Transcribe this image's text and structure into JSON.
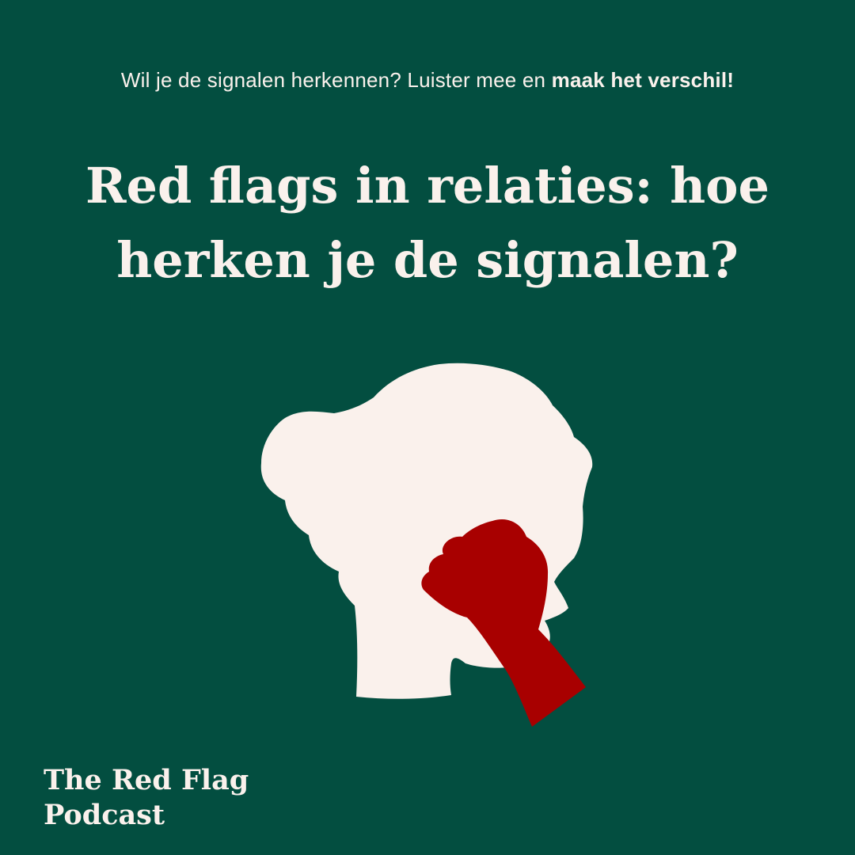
{
  "tagline": {
    "regular": "Wil je de signalen herkennen? Luister mee en ",
    "bold": "maak het verschil!"
  },
  "headline": {
    "line1": "Red flags in relaties: hoe",
    "line2": "herken je de signalen?"
  },
  "brand": {
    "line1": "The Red Flag",
    "line2": "Podcast"
  },
  "illustration": {
    "head_icon": "head-silhouette-icon",
    "fist_icon": "fist-icon"
  },
  "colors": {
    "background": "#034e40",
    "cream": "#faf1ec",
    "red": "#a80000"
  }
}
